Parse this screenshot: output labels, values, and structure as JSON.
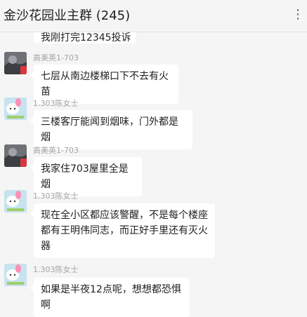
{
  "header": {
    "title": "金沙花园业主群 (245)",
    "more_icon": "ellipsis-icon"
  },
  "messages": [
    {
      "sender": "",
      "text": "我刚打完12345投诉",
      "partial": true
    },
    {
      "sender": "高美英1-703",
      "text": "七层从南边楼梯口下不去有火苗",
      "avatar": "dark"
    },
    {
      "sender": "1.303陈女士",
      "text": "三楼客厅能闻到烟味，门外都是烟",
      "avatar": "light"
    },
    {
      "sender": "高美英1-703",
      "text": "我家住703屋里全是烟",
      "avatar": "dark"
    },
    {
      "sender": "1.303陈女士",
      "text": "现在全小区都应该警醒，不是每个楼座都有王明伟同志，而正好手里还有灭火器",
      "avatar": "light"
    },
    {
      "sender": "1.303陈女士",
      "text": "如果是半夜12点呢，想想都恐惧啊",
      "avatar": "light"
    }
  ]
}
